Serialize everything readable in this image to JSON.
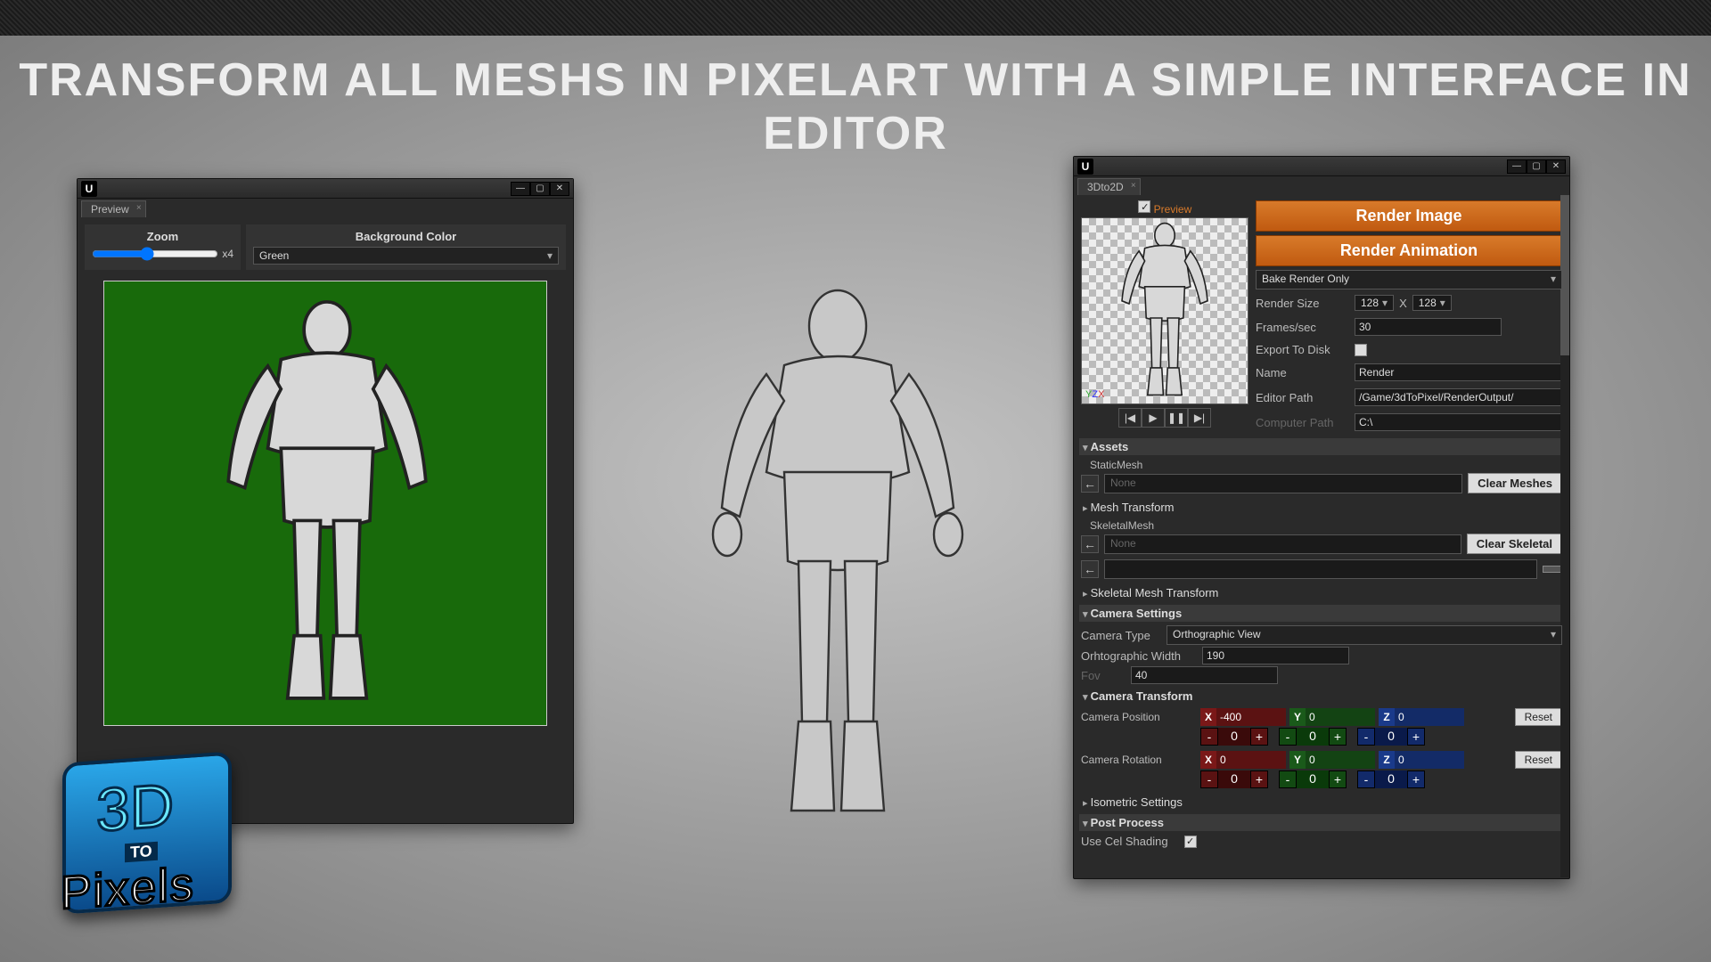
{
  "headline": "TRANSFORM ALL MESHS IN PIXELART WITH A SIMPLE INTERFACE IN EDITOR",
  "logo": {
    "top": "3D",
    "mid": "TO",
    "bottom": "Pixels"
  },
  "preview": {
    "tab": "Preview",
    "zoom_label": "Zoom",
    "zoom_value": "x4",
    "bg_label": "Background Color",
    "bg_value": "Green"
  },
  "settings": {
    "tab": "3Dto2D",
    "preview_check_label": "Preview",
    "render_image": "Render Image",
    "render_anim": "Render Animation",
    "bake_mode": "Bake Render Only",
    "render_size_label": "Render Size",
    "render_size_w": "128",
    "render_size_h": "128",
    "size_sep": "X",
    "fps_label": "Frames/sec",
    "fps": "30",
    "export_label": "Export To Disk",
    "name_label": "Name",
    "name_value": "Render",
    "editor_path_label": "Editor Path",
    "editor_path": "/Game/3dToPixel/RenderOutput/",
    "computer_path_label": "Computer Path",
    "computer_path": "C:\\",
    "assets_hdr": "Assets",
    "static_mesh": "StaticMesh",
    "none": "None",
    "clear_meshes": "Clear Meshes",
    "mesh_transform": "Mesh Transform",
    "skeletal_mesh": "SkeletalMesh",
    "clear_skeletal": "Clear Skeletal",
    "skel_transform": "Skeletal Mesh Transform",
    "cam_hdr": "Camera Settings",
    "cam_type_label": "Camera Type",
    "cam_type": "Orthographic View",
    "ortho_label": "Orhtographic Width",
    "ortho": "190",
    "fov_label": "Fov",
    "fov": "40",
    "cam_transform": "Camera Transform",
    "cam_pos": "Camera Position",
    "cam_rot": "Camera Rotation",
    "reset": "Reset",
    "pos": {
      "x": "-400",
      "y": "0",
      "z": "0"
    },
    "rot": {
      "x": "0",
      "y": "0",
      "z": "0"
    },
    "spin_zero": "0",
    "iso": "Isometric Settings",
    "post_hdr": "Post Process",
    "cel_label": "Use Cel Shading"
  }
}
